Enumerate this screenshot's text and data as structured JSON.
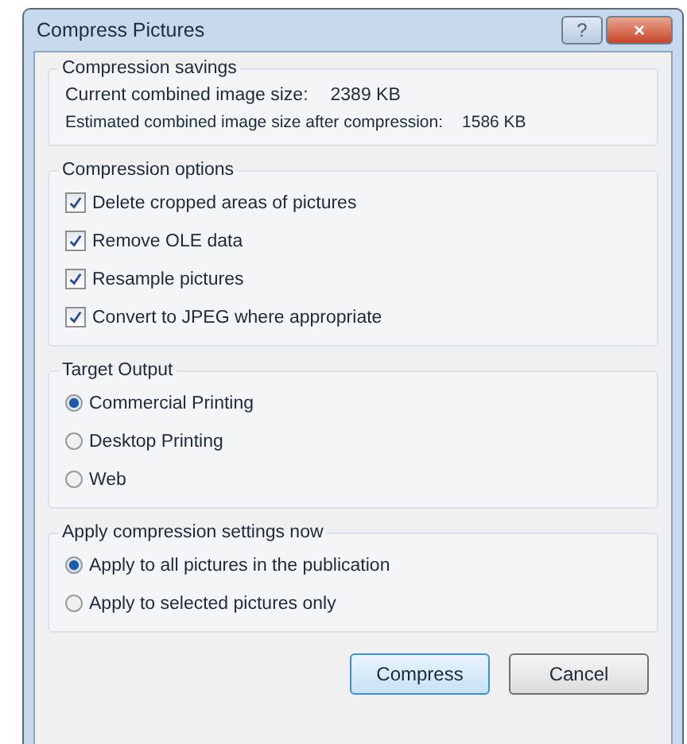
{
  "window": {
    "title": "Compress Pictures",
    "buttons": [
      "?",
      "×"
    ]
  },
  "savings": {
    "title": "Compression savings",
    "rows": [
      {
        "label": "Current combined image size:",
        "value": "2389 KB"
      },
      {
        "label": "Estimated combined image size after compression:",
        "value": "1586 KB"
      }
    ]
  },
  "options": {
    "title": "Compression options",
    "items": [
      {
        "label": "Delete cropped areas of pictures",
        "checked": true
      },
      {
        "label": "Remove OLE data",
        "checked": true
      },
      {
        "label": "Resample pictures",
        "checked": true
      },
      {
        "label": "Convert to JPEG where appropriate",
        "checked": true
      }
    ]
  },
  "target": {
    "title": "Target Output",
    "items": [
      {
        "label": "Commercial Printing",
        "selected": true
      },
      {
        "label": "Desktop Printing",
        "selected": false
      },
      {
        "label": "Web",
        "selected": false
      }
    ]
  },
  "apply": {
    "title": "Apply compression settings now",
    "items": [
      {
        "label": "Apply to all pictures in the publication",
        "selected": true
      },
      {
        "label": "Apply to selected pictures only",
        "selected": false
      }
    ]
  },
  "buttons": [
    {
      "label": "Compress",
      "default": true
    },
    {
      "label": "Cancel",
      "default": false
    }
  ]
}
